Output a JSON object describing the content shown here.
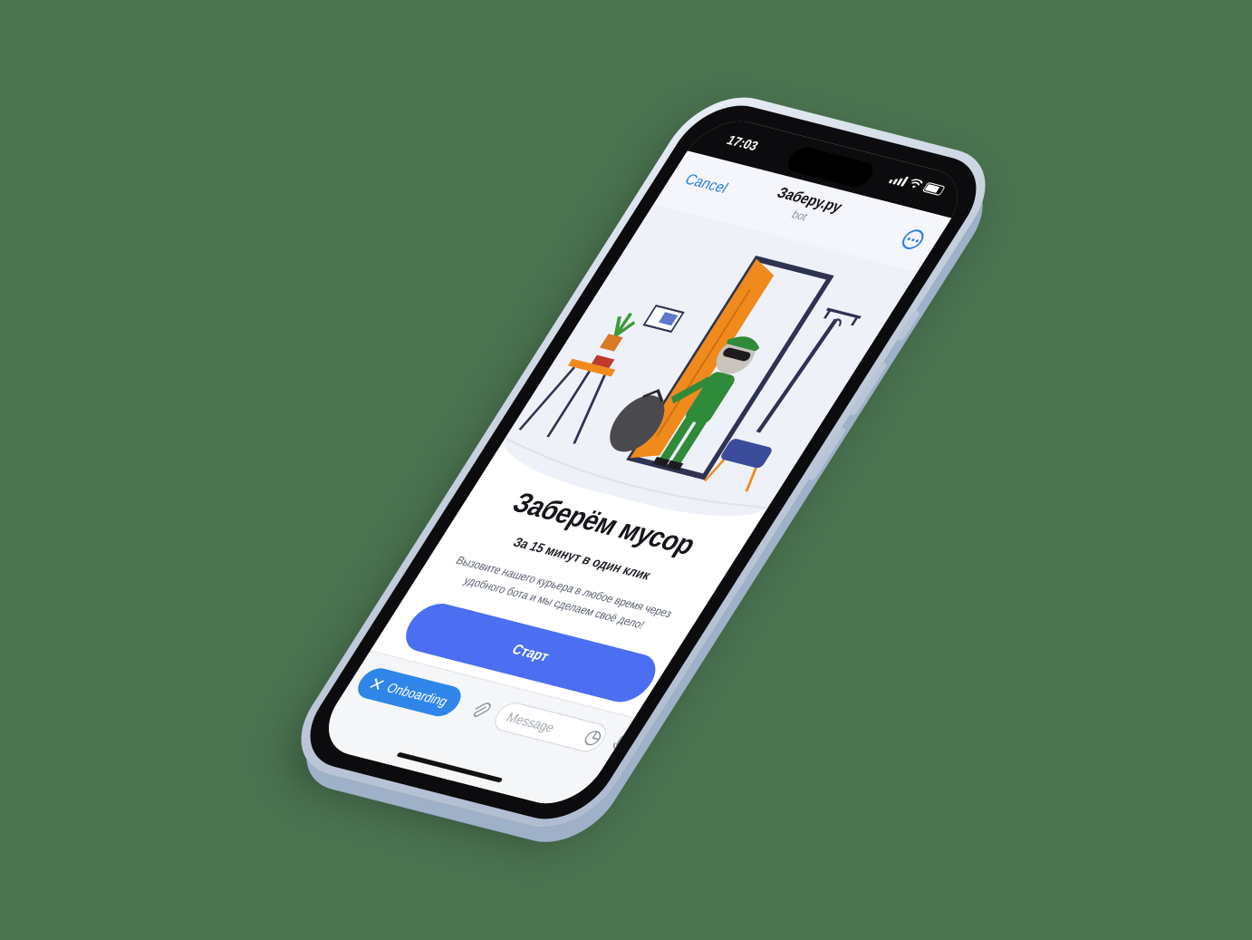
{
  "status_bar": {
    "time": "17:03"
  },
  "header": {
    "cancel_label": "Cancel",
    "title": "Заберу.ру",
    "subtitle": "bot",
    "more_icon": "more-horizontal-icon"
  },
  "hero": {
    "headline": "Заберём мусор",
    "subheadline": "За 15 минут в один клик",
    "description": "Вызовите нашего курьера в любое время через удобного бота и мы сделаем своё дело!",
    "cta_label": "Старт"
  },
  "composer": {
    "chip_label": "Onboarding",
    "chip_icon": "close-icon",
    "attach_icon": "paperclip-icon",
    "placeholder": "Message",
    "sticker_icon": "sticker-icon",
    "mic_icon": "microphone-icon"
  },
  "colors": {
    "accent": "#4b6ff0",
    "link": "#2f7de1",
    "chip": "#2f86e8",
    "background": "#4a7350"
  }
}
